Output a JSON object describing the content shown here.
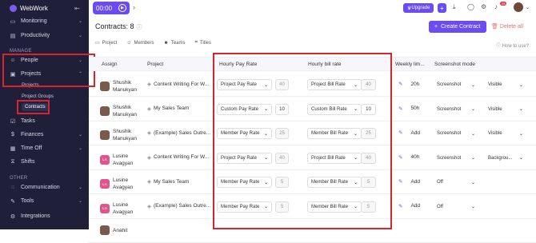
{
  "app": {
    "name": "WebWork"
  },
  "sidebar": {
    "items": [
      {
        "label": "Monitoring",
        "icon": "monitor-icon"
      },
      {
        "label": "Productivity",
        "icon": "chart-icon"
      },
      {
        "label": "People",
        "icon": "people-icon"
      },
      {
        "label": "Projects",
        "icon": "folder-icon"
      },
      {
        "label": "Tasks",
        "icon": "tasks-icon"
      },
      {
        "label": "Finances",
        "icon": "dollar-icon"
      },
      {
        "label": "Time Off",
        "icon": "calendar-icon"
      },
      {
        "label": "Shifts",
        "icon": "shifts-icon"
      },
      {
        "label": "Communication",
        "icon": "chat-icon"
      },
      {
        "label": "Tools",
        "icon": "tools-icon"
      },
      {
        "label": "Integrations",
        "icon": "plug-icon"
      }
    ],
    "section_manage": "MANAGE",
    "section_other": "OTHER",
    "sub": [
      "Projects",
      "Project Groups",
      "Contracts"
    ]
  },
  "topbar": {
    "timer": "00:00",
    "upgrade": "Upgrade",
    "notif_count": "25"
  },
  "page": {
    "title": "Contracts: 8",
    "create": "Create Contract",
    "delete_all": "Delete all",
    "how_to": "How to use?",
    "tabs": [
      "Project",
      "Members",
      "Teams",
      "Titles"
    ]
  },
  "table": {
    "headers": [
      "Assign",
      "Project",
      "Hourly Pay Rate",
      "Hourly bill rate",
      "Weekly lim...",
      "Screenshot mode"
    ],
    "rows": [
      {
        "name": "Shushik Manukyan",
        "avatar": "photo",
        "project": "Content Writing For W...",
        "pay_type": "Project Pay Rate",
        "pay": "40",
        "bill_type": "Project Bill Rate",
        "bill": "40",
        "weekly": "20h",
        "ss_mode": "Screenshot",
        "ss_vis": "Visible"
      },
      {
        "name": "Shushik Manukyan",
        "avatar": "photo",
        "project": "My Sales Team",
        "pay_type": "Custom Pay Rate",
        "pay": "10",
        "bill_type": "Custom Bill Rate",
        "bill": "10",
        "weekly": "50h",
        "ss_mode": "Screenshot",
        "ss_vis": "Visible"
      },
      {
        "name": "Shushik Manukyan",
        "avatar": "photo",
        "project": "(Example) Sales Outre...",
        "pay_type": "Member Pay Rate",
        "pay": "25",
        "bill_type": "Member Bill Rate",
        "bill": "25",
        "weekly": "Add",
        "ss_mode": "Screenshot",
        "ss_vis": "Visible"
      },
      {
        "name": "Lusine Avagyan",
        "avatar": "LA",
        "project": "Content Writing For W...",
        "pay_type": "Project Pay Rate",
        "pay": "40",
        "bill_type": "Project Bill Rate",
        "bill": "40",
        "weekly": "40h",
        "ss_mode": "Screenshot",
        "ss_vis": "Backgrou..."
      },
      {
        "name": "Lusine Avagyan",
        "avatar": "LA",
        "project": "My Sales Team",
        "pay_type": "Member Pay Rate",
        "pay": "5",
        "bill_type": "Member Bill Rate",
        "bill": "5",
        "weekly": "Add",
        "ss_mode": "Off",
        "ss_vis": ""
      },
      {
        "name": "Lusine Avagyan",
        "avatar": "LA",
        "project": "(Example) Sales Outre...",
        "pay_type": "Member Pay Rate",
        "pay": "5",
        "bill_type": "Member Bill Rate",
        "bill": "5",
        "weekly": "Add",
        "ss_mode": "Off",
        "ss_vis": ""
      },
      {
        "name": "Anahit",
        "avatar": "photo",
        "project": "",
        "pay_type": "",
        "pay": "",
        "bill_type": "",
        "bill": "",
        "weekly": "",
        "ss_mode": "",
        "ss_vis": ""
      }
    ]
  }
}
